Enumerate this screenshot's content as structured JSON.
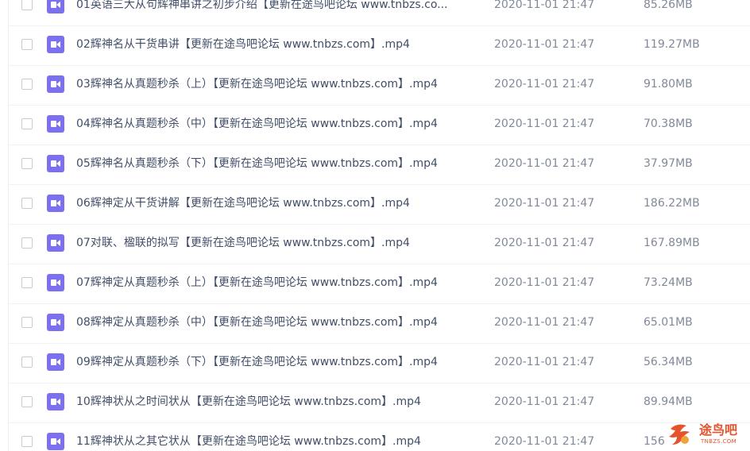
{
  "file_list": {
    "rows": [
      {
        "name": "01英语三大从句辉神串讲之初步介绍【更新在途鸟吧论坛 www.tnbzs.co...",
        "date": "2020-11-01 21:47",
        "size": "85.26MB"
      },
      {
        "name": "02辉神名从干货串讲【更新在途鸟吧论坛 www.tnbzs.com】.mp4",
        "date": "2020-11-01 21:47",
        "size": "119.27MB"
      },
      {
        "name": "03辉神名从真题秒杀（上）【更新在途鸟吧论坛 www.tnbzs.com】.mp4",
        "date": "2020-11-01 21:47",
        "size": "91.80MB"
      },
      {
        "name": "04辉神名从真题秒杀（中）【更新在途鸟吧论坛 www.tnbzs.com】.mp4",
        "date": "2020-11-01 21:47",
        "size": "70.38MB"
      },
      {
        "name": "05辉神名从真题秒杀（下）【更新在途鸟吧论坛 www.tnbzs.com】.mp4",
        "date": "2020-11-01 21:47",
        "size": "37.97MB"
      },
      {
        "name": "06辉神定从干货讲解【更新在途鸟吧论坛 www.tnbzs.com】.mp4",
        "date": "2020-11-01 21:47",
        "size": "186.22MB"
      },
      {
        "name": "07对联、楹联的拟写【更新在途鸟吧论坛 www.tnbzs.com】.mp4",
        "date": "2020-11-01 21:47",
        "size": "167.89MB"
      },
      {
        "name": "07辉神定从真题秒杀（上）【更新在途鸟吧论坛 www.tnbzs.com】.mp4",
        "date": "2020-11-01 21:47",
        "size": "73.24MB"
      },
      {
        "name": "08辉神定从真题秒杀（中）【更新在途鸟吧论坛 www.tnbzs.com】.mp4",
        "date": "2020-11-01 21:47",
        "size": "65.01MB"
      },
      {
        "name": "09辉神定从真题秒杀（下）【更新在途鸟吧论坛 www.tnbzs.com】.mp4",
        "date": "2020-11-01 21:47",
        "size": "56.34MB"
      },
      {
        "name": "10辉神状从之时间状从【更新在途鸟吧论坛 www.tnbzs.com】.mp4",
        "date": "2020-11-01 21:47",
        "size": "89.94MB"
      },
      {
        "name": "11辉神状从之其它状从【更新在途鸟吧论坛 www.tnbzs.com】.mp4",
        "date": "2020-11-01 21:47",
        "size": "156"
      }
    ],
    "file_icon": "video-file-icon",
    "accent_color": "#7c6ff0"
  },
  "watermark": {
    "text": "途鸟吧",
    "subtext": "TNBZS.COM",
    "icon": "bird-logo-icon",
    "color": "#e5532c"
  }
}
